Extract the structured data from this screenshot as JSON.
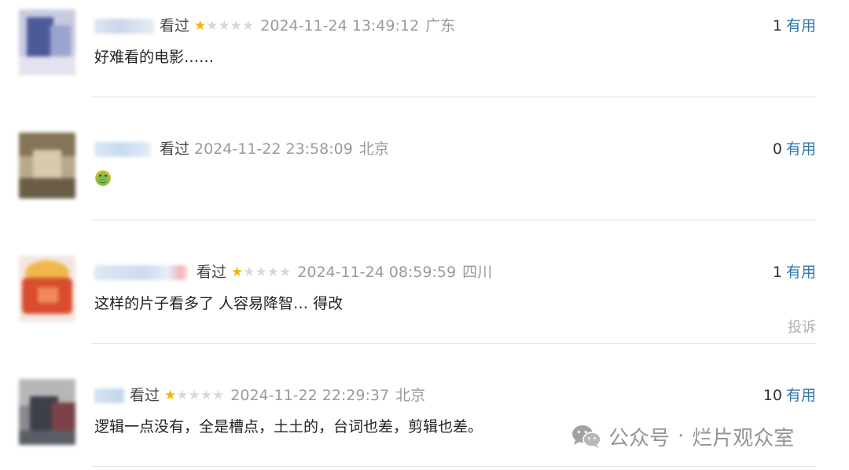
{
  "comments": [
    {
      "status": "看过",
      "rating": 1,
      "time": "2024-11-24 13:49:12",
      "location": "广东",
      "useful_count": "1",
      "useful_label": "有用",
      "text": "好难看的电影……"
    },
    {
      "status": "看过",
      "rating": 0,
      "time": "2024-11-22 23:58:09",
      "location": "北京",
      "useful_count": "0",
      "useful_label": "有用",
      "text": "",
      "emoji": "nauseated-face-emoji"
    },
    {
      "status": "看过",
      "rating": 1,
      "time": "2024-11-24 08:59:59",
      "location": "四川",
      "useful_count": "1",
      "useful_label": "有用",
      "text": "这样的片子看多了 人容易降智… 得改",
      "report_label": "投诉"
    },
    {
      "status": "看过",
      "rating": 1,
      "time": "2024-11-22 22:29:37",
      "location": "北京",
      "useful_count": "10",
      "useful_label": "有用",
      "text": "逻辑一点没有，全是槽点，土土的，台词也差，剪辑也差。"
    }
  ],
  "watermark": {
    "icon": "wechat-icon",
    "text": "公众号",
    "dot": "·",
    "account": "烂片观众室"
  },
  "colors": {
    "star_on": "#f4b400",
    "star_off": "#d8d8d8",
    "useful_link": "#3377aa",
    "meta_gray": "#9a9a9a"
  }
}
